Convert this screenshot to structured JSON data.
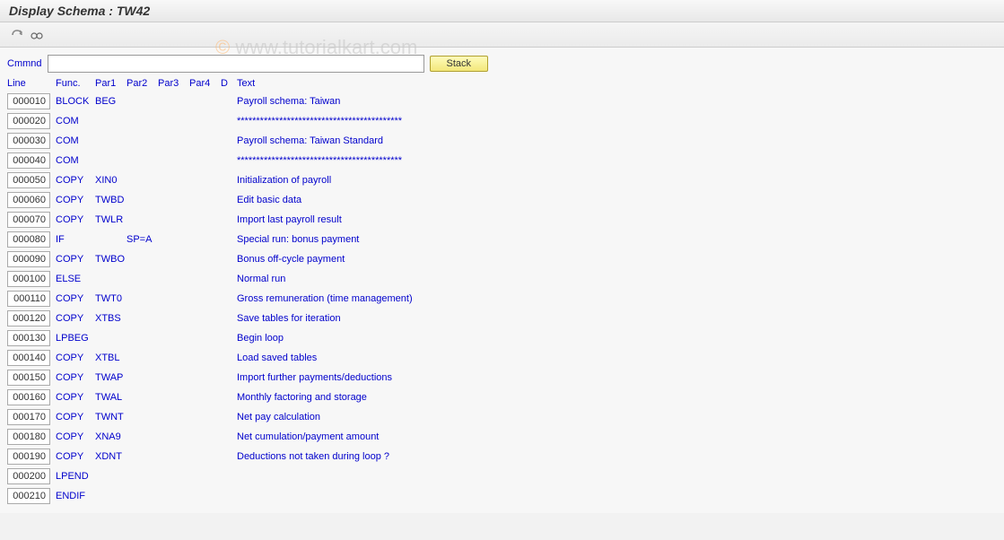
{
  "header": {
    "title": "Display Schema : TW42"
  },
  "watermark": {
    "copy": "©",
    "text": "www.tutorialkart.com"
  },
  "command": {
    "label": "Cmmnd",
    "value": "",
    "stack_label": "Stack"
  },
  "columns": {
    "line": "Line",
    "func": "Func.",
    "par1": "Par1",
    "par2": "Par2",
    "par3": "Par3",
    "par4": "Par4",
    "d": "D",
    "text": "Text"
  },
  "rows": [
    {
      "line": "000010",
      "func": "BLOCK",
      "par1": "BEG",
      "par2": "",
      "par3": "",
      "par4": "",
      "d": "",
      "text": "Payroll schema: Taiwan"
    },
    {
      "line": "000020",
      "func": "COM",
      "par1": "",
      "par2": "",
      "par3": "",
      "par4": "",
      "d": "",
      "text": "*******************************************"
    },
    {
      "line": "000030",
      "func": "COM",
      "par1": "",
      "par2": "",
      "par3": "",
      "par4": "",
      "d": "",
      "text": "Payroll schema: Taiwan Standard"
    },
    {
      "line": "000040",
      "func": "COM",
      "par1": "",
      "par2": "",
      "par3": "",
      "par4": "",
      "d": "",
      "text": "*******************************************"
    },
    {
      "line": "000050",
      "func": "COPY",
      "par1": "XIN0",
      "par2": "",
      "par3": "",
      "par4": "",
      "d": "",
      "text": "Initialization of payroll"
    },
    {
      "line": "000060",
      "func": "COPY",
      "par1": "TWBD",
      "par2": "",
      "par3": "",
      "par4": "",
      "d": "",
      "text": "Edit basic data"
    },
    {
      "line": "000070",
      "func": "COPY",
      "par1": "TWLR",
      "par2": "",
      "par3": "",
      "par4": "",
      "d": "",
      "text": "Import last payroll result"
    },
    {
      "line": "000080",
      "func": "IF",
      "par1": "",
      "par2": "SP=A",
      "par3": "",
      "par4": "",
      "d": "",
      "text": "Special run: bonus payment"
    },
    {
      "line": "000090",
      "func": "COPY",
      "par1": "TWBO",
      "par2": "",
      "par3": "",
      "par4": "",
      "d": "",
      "text": "Bonus off-cycle payment"
    },
    {
      "line": "000100",
      "func": "ELSE",
      "par1": "",
      "par2": "",
      "par3": "",
      "par4": "",
      "d": "",
      "text": "Normal run"
    },
    {
      "line": "000110",
      "func": "COPY",
      "par1": "TWT0",
      "par2": "",
      "par3": "",
      "par4": "",
      "d": "",
      "text": "Gross remuneration (time management)"
    },
    {
      "line": "000120",
      "func": "COPY",
      "par1": "XTBS",
      "par2": "",
      "par3": "",
      "par4": "",
      "d": "",
      "text": "Save tables for iteration"
    },
    {
      "line": "000130",
      "func": "LPBEG",
      "par1": "",
      "par2": "",
      "par3": "",
      "par4": "",
      "d": "",
      "text": "Begin loop"
    },
    {
      "line": "000140",
      "func": "COPY",
      "par1": "XTBL",
      "par2": "",
      "par3": "",
      "par4": "",
      "d": "",
      "text": "Load saved tables"
    },
    {
      "line": "000150",
      "func": "COPY",
      "par1": "TWAP",
      "par2": "",
      "par3": "",
      "par4": "",
      "d": "",
      "text": "Import further payments/deductions"
    },
    {
      "line": "000160",
      "func": "COPY",
      "par1": "TWAL",
      "par2": "",
      "par3": "",
      "par4": "",
      "d": "",
      "text": "Monthly factoring and storage"
    },
    {
      "line": "000170",
      "func": "COPY",
      "par1": "TWNT",
      "par2": "",
      "par3": "",
      "par4": "",
      "d": "",
      "text": "Net pay calculation"
    },
    {
      "line": "000180",
      "func": "COPY",
      "par1": "XNA9",
      "par2": "",
      "par3": "",
      "par4": "",
      "d": "",
      "text": "Net cumulation/payment amount"
    },
    {
      "line": "000190",
      "func": "COPY",
      "par1": "XDNT",
      "par2": "",
      "par3": "",
      "par4": "",
      "d": "",
      "text": "Deductions not taken during loop ?"
    },
    {
      "line": "000200",
      "func": "LPEND",
      "par1": "",
      "par2": "",
      "par3": "",
      "par4": "",
      "d": "",
      "text": ""
    },
    {
      "line": "000210",
      "func": "ENDIF",
      "par1": "",
      "par2": "",
      "par3": "",
      "par4": "",
      "d": "",
      "text": ""
    }
  ]
}
